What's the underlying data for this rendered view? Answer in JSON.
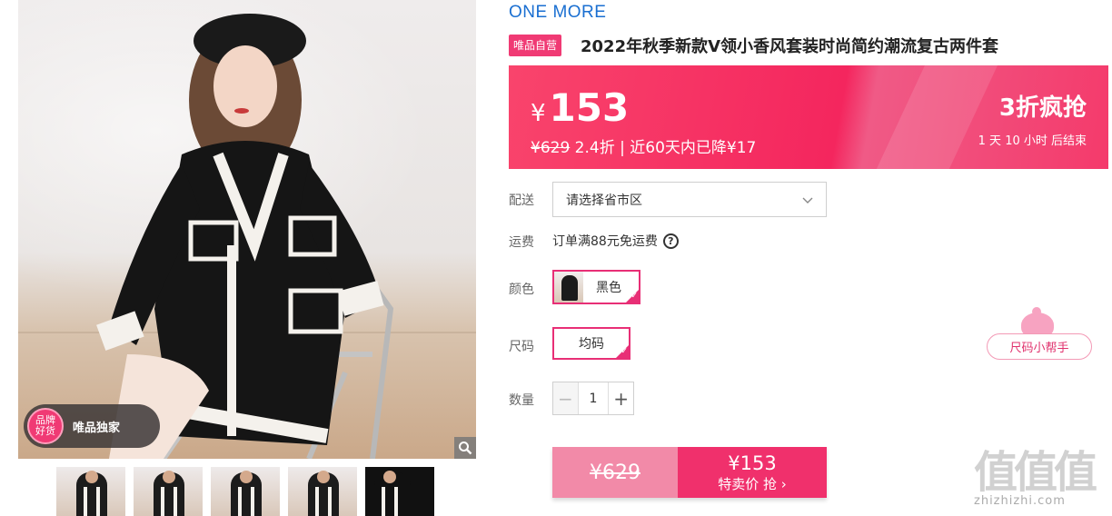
{
  "gallery": {
    "badge_line1": "品牌",
    "badge_line2": "好货",
    "badge_text": "唯品独家",
    "zoom_icon": "magnifier-icon",
    "thumbnail_count": 5
  },
  "product": {
    "brand": "ONE MORE",
    "self_tag": "唯品自营",
    "title": "2022年秋季新款V领小香风套装时尚简约潮流复古两件套"
  },
  "price": {
    "currency": "¥",
    "current": "153",
    "original": "¥629",
    "discount": "2.4折",
    "separator": "|",
    "recent_drop": "近60天内已降¥17",
    "promo": "3折疯抢",
    "countdown": "1 天 10 小时 后结束"
  },
  "delivery": {
    "label": "配送",
    "value": "请选择省市区"
  },
  "shipping": {
    "label": "运费",
    "text": "订单满88元免运费",
    "help_icon": "question-circle-icon"
  },
  "color": {
    "label": "颜色",
    "selected": "黑色"
  },
  "size": {
    "label": "尺码",
    "selected": "均码",
    "helper": "尺码小帮手"
  },
  "quantity": {
    "label": "数量",
    "minus": "−",
    "value": "1",
    "plus": "+"
  },
  "buy_button": {
    "original": "¥629",
    "price": "¥153",
    "label": "特卖价 抢 ›"
  },
  "watermark": {
    "big": "值值值",
    "small": "zhizhizhi.com"
  },
  "colors": {
    "accent": "#f0306c",
    "brand_blue": "#1a6fd1"
  }
}
